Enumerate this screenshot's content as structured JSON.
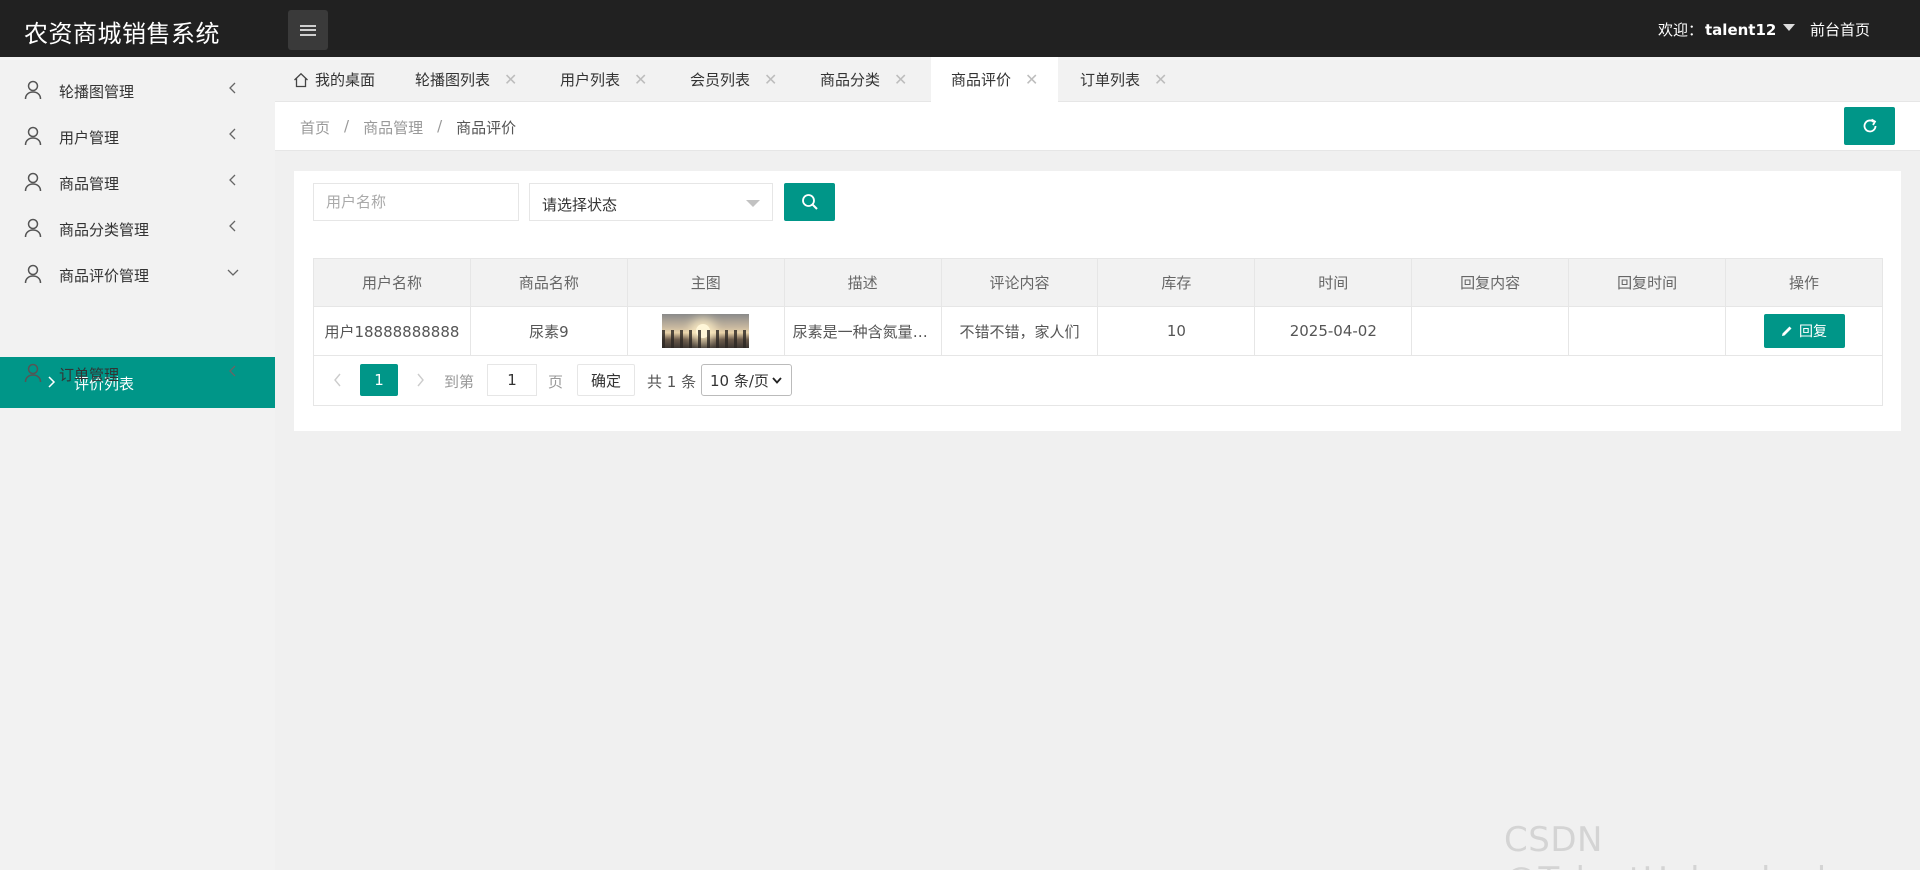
{
  "header": {
    "brand": "农资商城销售系统",
    "welcome_prefix": "欢迎：",
    "username": "talent12",
    "front_link": "前台首页"
  },
  "sidebar": {
    "items": [
      {
        "label": "轮播图管理"
      },
      {
        "label": "用户管理"
      },
      {
        "label": "商品管理"
      },
      {
        "label": "商品分类管理"
      },
      {
        "label": "商品评价管理"
      },
      {
        "label": "订单管理"
      }
    ],
    "active_sub": "评价列表"
  },
  "tabs": [
    {
      "label": "我的桌面"
    },
    {
      "label": "轮播图列表"
    },
    {
      "label": "用户列表"
    },
    {
      "label": "会员列表"
    },
    {
      "label": "商品分类"
    },
    {
      "label": "商品评价"
    },
    {
      "label": "订单列表"
    }
  ],
  "breadcrumb": [
    "首页",
    "商品管理",
    "商品评价"
  ],
  "search": {
    "username_placeholder": "用户名称",
    "status_select": "请选择状态"
  },
  "table": {
    "headers": [
      "用户名称",
      "商品名称",
      "主图",
      "描述",
      "评论内容",
      "库存",
      "时间",
      "回复内容",
      "回复时间",
      "操作"
    ],
    "rows": [
      {
        "username": "用户18888888888",
        "product": "尿素9",
        "description": "尿素是一种含氮量高的肥料",
        "comment": "不错不错，家人们",
        "stock": "10",
        "time": "2025-04-02",
        "reply_content": "",
        "reply_time": "",
        "action": "回复"
      }
    ]
  },
  "pagination": {
    "current": "1",
    "goto_label": "到第",
    "goto_value": "1",
    "page_label": "页",
    "confirm": "确定",
    "total": "共 1 条",
    "page_size": "10 条/页"
  },
  "watermark": "CSDN @TalentUnleashed",
  "colors": {
    "accent": "#009688",
    "header_bg": "#212121",
    "sidebar_bg": "#f2f2f2"
  }
}
